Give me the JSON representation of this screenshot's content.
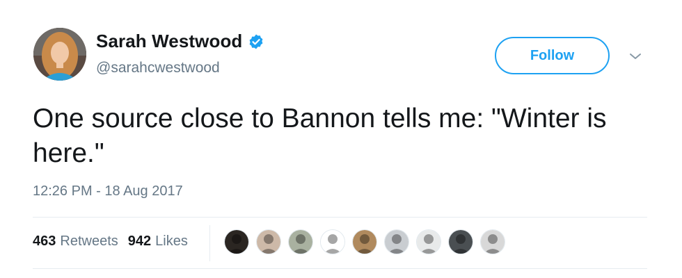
{
  "user": {
    "display_name": "Sarah Westwood",
    "handle": "@sarahcwestwood",
    "verified": true,
    "avatar_icon": "profile-photo"
  },
  "follow_label": "Follow",
  "caret_icon": "chevron-down-icon",
  "tweet": {
    "text": "One source close to Bannon tells me: \"Winter is here.\"",
    "timestamp": "12:26 PM - 18 Aug 2017"
  },
  "stats": {
    "retweets_count": "463",
    "retweets_label": "Retweets",
    "likes_count": "942",
    "likes_label": "Likes"
  },
  "likers": [
    {
      "icon": "liker-avatar-1",
      "color": "#2b2622"
    },
    {
      "icon": "liker-avatar-2",
      "color": "#cdb9a8"
    },
    {
      "icon": "liker-avatar-3",
      "color": "#a9b1a0"
    },
    {
      "icon": "liker-avatar-4",
      "color": "#ffffff"
    },
    {
      "icon": "liker-avatar-5",
      "color": "#b08a5e"
    },
    {
      "icon": "liker-avatar-6",
      "color": "#c9cdd1"
    },
    {
      "icon": "liker-avatar-7",
      "color": "#e8eaea"
    },
    {
      "icon": "liker-avatar-8",
      "color": "#4a4f52"
    },
    {
      "icon": "liker-avatar-9",
      "color": "#d8d8d8"
    }
  ],
  "colors": {
    "accent": "#1da1f2",
    "secondary_text": "#657786",
    "primary_text": "#14171a",
    "divider": "#e6ecf0"
  }
}
